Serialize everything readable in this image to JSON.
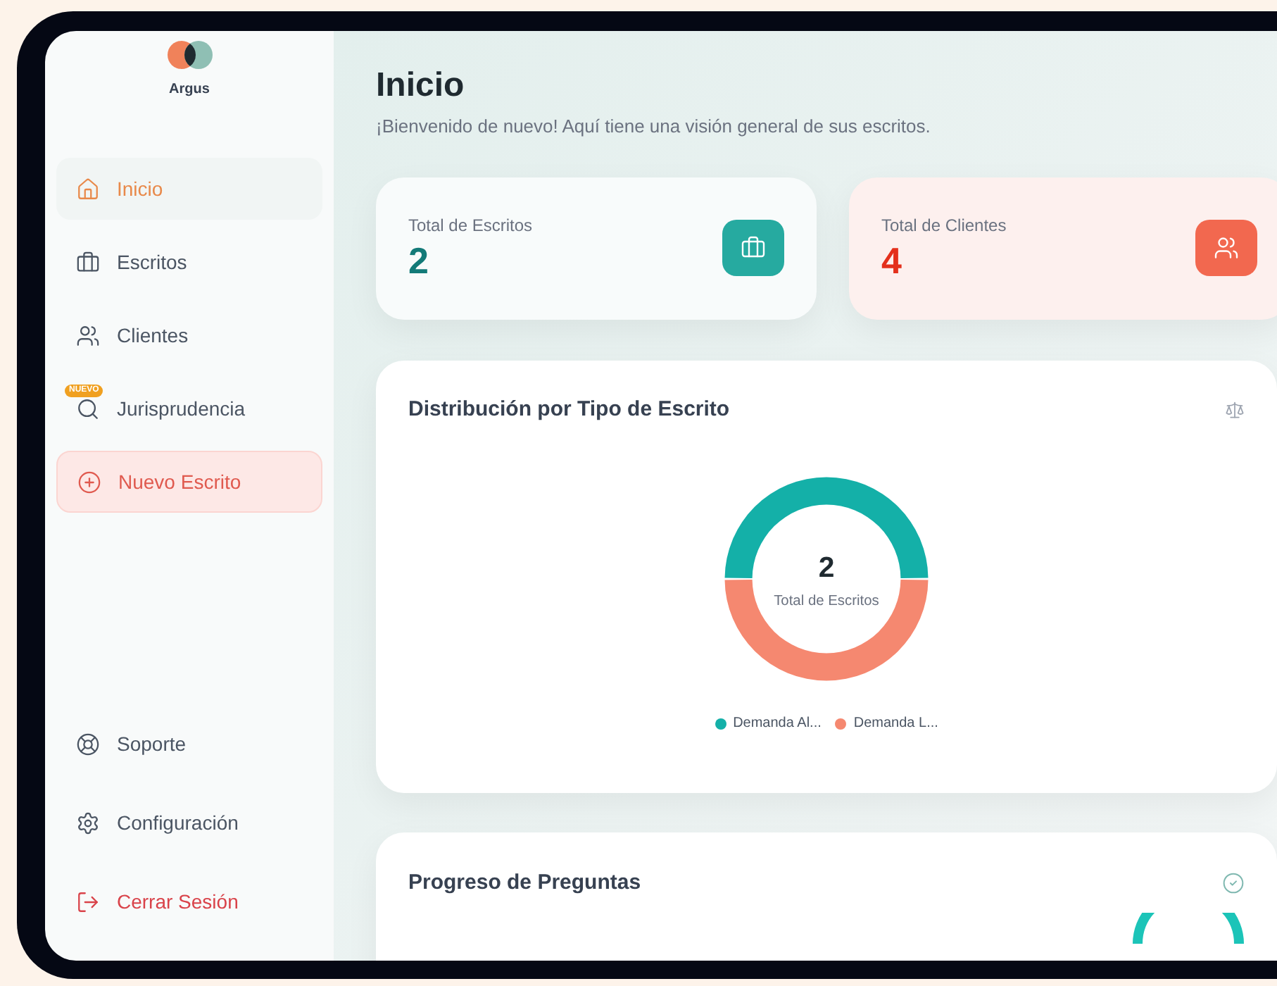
{
  "brand": {
    "name": "Argus"
  },
  "sidebar": {
    "items": [
      {
        "label": "Inicio",
        "kind": "nav",
        "selected": true
      },
      {
        "label": "Escritos",
        "kind": "nav",
        "selected": false
      },
      {
        "label": "Clientes",
        "kind": "nav",
        "selected": false
      },
      {
        "label": "Jurisprudencia",
        "kind": "nav",
        "selected": false,
        "badge": "NUEVO"
      },
      {
        "label": "Nuevo Escrito",
        "kind": "action"
      }
    ],
    "footer_items": [
      {
        "label": "Soporte",
        "kind": "nav"
      },
      {
        "label": "Configuración",
        "kind": "nav"
      },
      {
        "label": "Cerrar Sesión",
        "kind": "logout"
      }
    ]
  },
  "header": {
    "title": "Inicio",
    "subtitle": "¡Bienvenido de nuevo! Aquí tiene una visión general de sus escritos."
  },
  "stats": [
    {
      "label": "Total de Escritos",
      "value": "2",
      "kind": "teal"
    },
    {
      "label": "Total de Clientes",
      "value": "4",
      "kind": "coral"
    }
  ],
  "distribution": {
    "title": "Distribución por Tipo de Escrito",
    "center_value": "2",
    "center_label": "Total de Escritos",
    "chart_data": {
      "type": "donut",
      "categories": [
        "Demanda Al...",
        "Demanda L..."
      ],
      "values": [
        50,
        50
      ],
      "colors": [
        "#14b0a8",
        "#f58870"
      ],
      "legend": "bottom"
    }
  },
  "progress": {
    "title": "Progreso de Preguntas"
  }
}
